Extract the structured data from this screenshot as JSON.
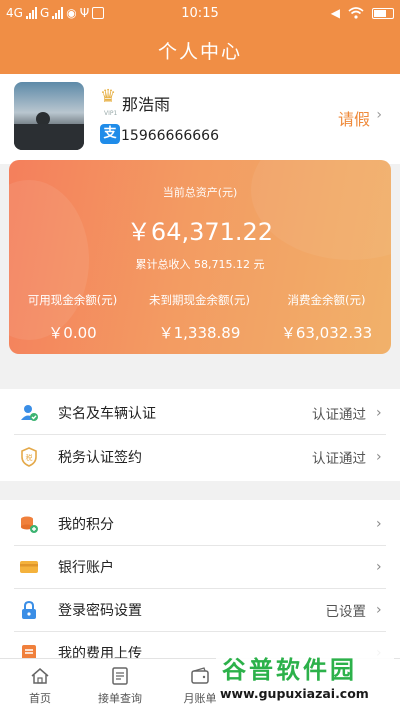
{
  "status_bar": {
    "net1": "4G",
    "net2": "G",
    "time": "10:15"
  },
  "title": "个人中心",
  "profile": {
    "name": "那浩雨",
    "vip_tag": "VIP1",
    "alipay_glyph": "支",
    "phone": "15966666666",
    "leave_label": "请假",
    "chevron": "›"
  },
  "assets": {
    "total_label": "当前总资产(元)",
    "total_value": "￥64,371.22",
    "income": "累计总收入 58,715.12 元",
    "columns": [
      {
        "label": "可用现金余额(元)",
        "value": "￥0.00"
      },
      {
        "label": "未到期现金余额(元)",
        "value": "￥1,338.89"
      },
      {
        "label": "消费金余额(元)",
        "value": "￥63,032.33"
      }
    ]
  },
  "verify_items": [
    {
      "label": "实名及车辆认证",
      "status": "认证通过",
      "icon": "user-verify-icon"
    },
    {
      "label": "税务认证签约",
      "status": "认证通过",
      "icon": "tax-shield-icon"
    }
  ],
  "menu_items": [
    {
      "label": "我的积分",
      "status": "",
      "icon": "coins-icon"
    },
    {
      "label": "银行账户",
      "status": "",
      "icon": "bank-card-icon"
    },
    {
      "label": "登录密码设置",
      "status": "已设置",
      "icon": "lock-icon"
    },
    {
      "label": "我的费用上传",
      "status": "",
      "icon": "upload-icon"
    }
  ],
  "chevron": "›",
  "tabs": [
    {
      "label": "首页",
      "icon": "home-icon"
    },
    {
      "label": "接单查询",
      "icon": "order-icon"
    },
    {
      "label": "月账单",
      "icon": "wallet-icon"
    }
  ],
  "watermark": {
    "title": "谷普软件园",
    "url": "www.gupuxiazai.com"
  },
  "colors": {
    "primary": "#f08e45",
    "card_start": "#f47f5c",
    "card_end": "#f1b16a",
    "accent_text": "#ef8a3b"
  }
}
